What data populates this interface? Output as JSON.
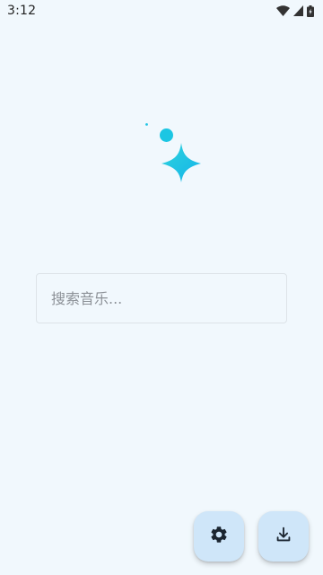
{
  "status_bar": {
    "time": "3:12",
    "icons": [
      "wifi-icon",
      "cellular-signal-icon",
      "battery-icon"
    ]
  },
  "logo": {
    "icon": "sparkle-icon",
    "colors": {
      "start": "#1ec8e0",
      "end": "#14b6ea"
    }
  },
  "search": {
    "placeholder": "搜索音乐...",
    "value": ""
  },
  "actions": {
    "settings_icon": "gear-icon",
    "download_icon": "download-icon"
  },
  "colors": {
    "background": "#f1f8fd",
    "fab_background": "#cfe6f9",
    "icon_dark": "#1b2530"
  }
}
